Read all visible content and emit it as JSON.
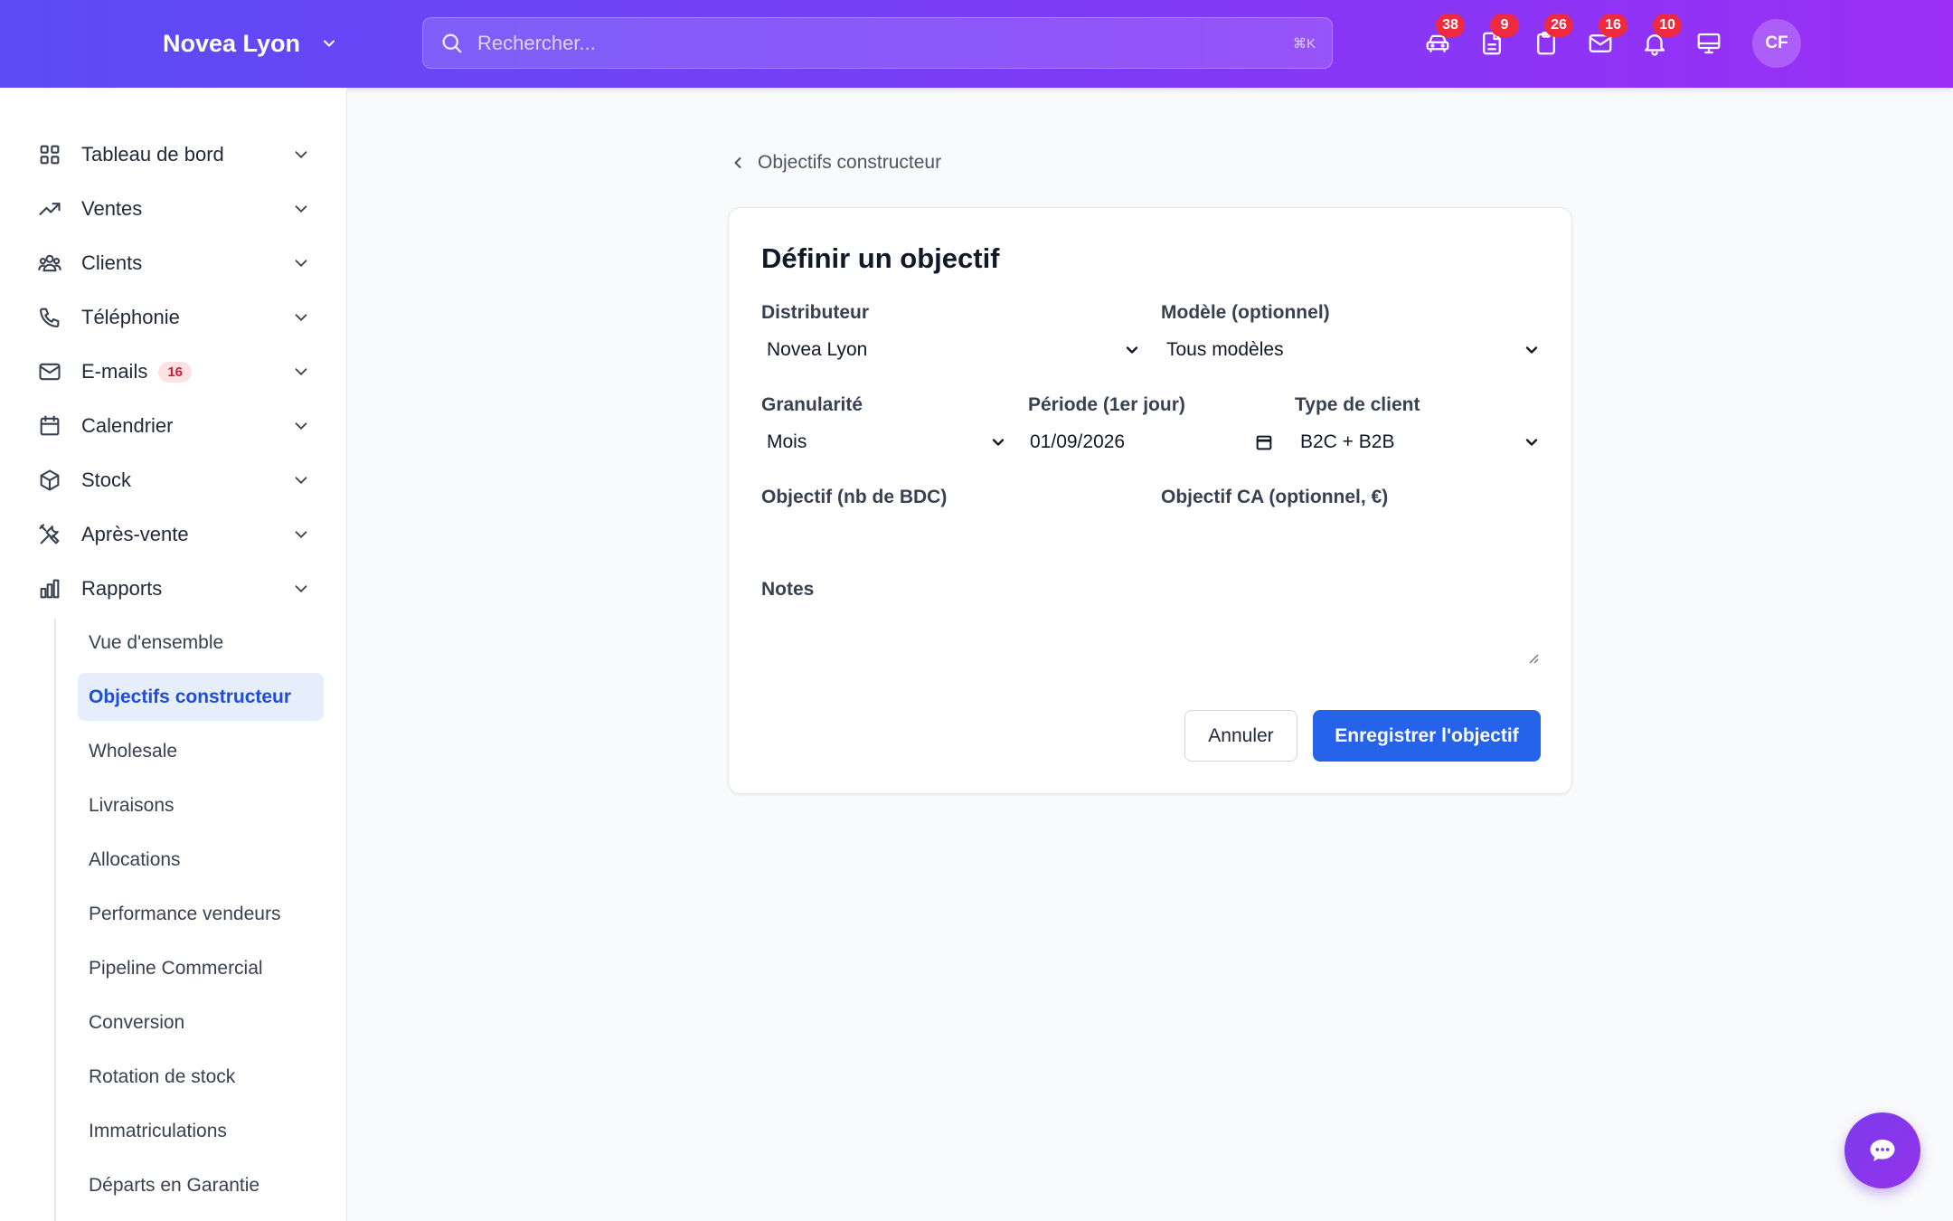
{
  "header": {
    "brand": "Novea Lyon",
    "search_placeholder": "Rechercher...",
    "search_shortcut": "⌘K",
    "icons": [
      {
        "name": "car-icon",
        "badge": "38"
      },
      {
        "name": "document-icon",
        "badge": "9"
      },
      {
        "name": "clipboard-icon",
        "badge": "26"
      },
      {
        "name": "mail-icon",
        "badge": "16"
      },
      {
        "name": "bell-icon",
        "badge": "10"
      },
      {
        "name": "monitor-icon",
        "badge": ""
      }
    ],
    "avatar_initials": "CF",
    "colors": {
      "gradient_start": "#5b4cf5",
      "gradient_end": "#9b2ff5",
      "badge": "#ef2a3f"
    }
  },
  "sidebar": {
    "items": [
      {
        "label": "Tableau de bord",
        "icon": "grid-icon"
      },
      {
        "label": "Ventes",
        "icon": "trend-up-icon"
      },
      {
        "label": "Clients",
        "icon": "users-icon"
      },
      {
        "label": "Téléphonie",
        "icon": "phone-icon"
      },
      {
        "label": "E-mails",
        "icon": "mail-icon",
        "count": "16"
      },
      {
        "label": "Calendrier",
        "icon": "calendar-icon"
      },
      {
        "label": "Stock",
        "icon": "box-icon"
      },
      {
        "label": "Après-vente",
        "icon": "tools-icon"
      },
      {
        "label": "Rapports",
        "icon": "bar-chart-icon"
      }
    ],
    "sub_items": [
      {
        "label": "Vue d'ensemble",
        "active": false
      },
      {
        "label": "Objectifs constructeur",
        "active": true
      },
      {
        "label": "Wholesale",
        "active": false
      },
      {
        "label": "Livraisons",
        "active": false
      },
      {
        "label": "Allocations",
        "active": false
      },
      {
        "label": "Performance vendeurs",
        "active": false
      },
      {
        "label": "Pipeline Commercial",
        "active": false
      },
      {
        "label": "Conversion",
        "active": false
      },
      {
        "label": "Rotation de stock",
        "active": false
      },
      {
        "label": "Immatriculations",
        "active": false
      },
      {
        "label": "Départs en Garantie",
        "active": false
      }
    ]
  },
  "main": {
    "back_link": "Objectifs constructeur",
    "form": {
      "title": "Définir un objectif",
      "distributeur": {
        "label": "Distributeur",
        "value": "Novea Lyon"
      },
      "modele": {
        "label": "Modèle (optionnel)",
        "value": "Tous modèles"
      },
      "granularite": {
        "label": "Granularité",
        "value": "Mois"
      },
      "periode": {
        "label": "Période (1er jour)",
        "value": "01/09/2026"
      },
      "type_client": {
        "label": "Type de client",
        "value": "B2C + B2B"
      },
      "objectif_bdc": {
        "label": "Objectif (nb de BDC)",
        "value": ""
      },
      "objectif_ca": {
        "label": "Objectif CA (optionnel, €)",
        "value": ""
      },
      "notes": {
        "label": "Notes",
        "value": ""
      },
      "cancel_label": "Annuler",
      "save_label": "Enregistrer l'objectif"
    }
  },
  "accent_color": "#2563eb"
}
